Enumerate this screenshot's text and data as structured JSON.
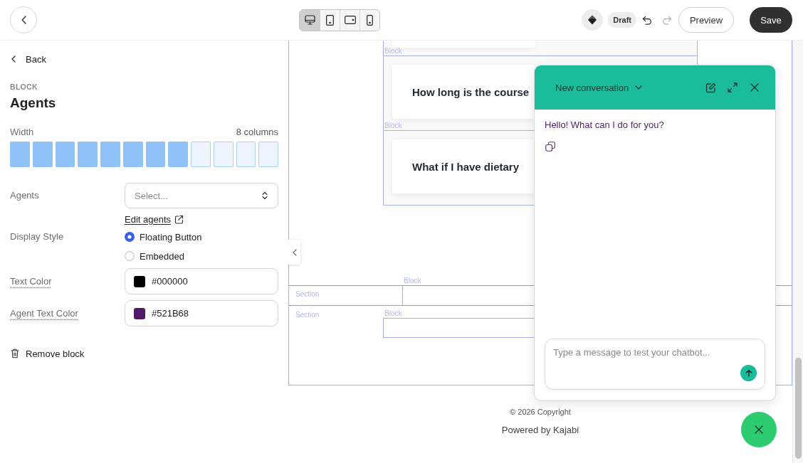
{
  "top_bar": {
    "view_modes": [
      {
        "kind": "desktop",
        "selected": true
      },
      {
        "kind": "tablet",
        "selected": false
      },
      {
        "kind": "tablet_landscape",
        "selected": false
      },
      {
        "kind": "mobile",
        "selected": false
      }
    ],
    "status": "Draft",
    "undo": {
      "disabled": false
    },
    "redo": {
      "disabled": true
    },
    "preview_button": "Preview",
    "save_button": "Save"
  },
  "sidebar": {
    "back_link": "Back",
    "eyebrow": "BLOCK",
    "title": "Agents",
    "width": {
      "label": "Width",
      "value": "8 columns",
      "columns": [
        {
          "filled": true
        },
        {
          "filled": true
        },
        {
          "filled": true
        },
        {
          "filled": true
        },
        {
          "filled": true
        },
        {
          "filled": true
        },
        {
          "filled": true
        },
        {
          "filled": true
        },
        {
          "filled": false
        },
        {
          "filled": false
        },
        {
          "filled": false
        },
        {
          "filled": false
        }
      ]
    },
    "fields": [
      {
        "kind": "select",
        "label": "Agents",
        "has_tooltip": false,
        "placeholder": "Select...",
        "link": "Edit agents"
      },
      {
        "kind": "radio",
        "label": "Display Style",
        "has_tooltip": false,
        "options": [
          {
            "label": "Floating Button",
            "selected": true
          },
          {
            "label": "Embedded",
            "selected": false
          }
        ]
      },
      {
        "kind": "color",
        "label": "Text Color",
        "has_tooltip": true,
        "value": "#000000",
        "color": "#000000"
      },
      {
        "kind": "color",
        "label": "Agent Text Color",
        "has_tooltip": true,
        "value": "#521B68",
        "color": "#521b68"
      }
    ],
    "remove_button": "Remove block"
  },
  "canvas": {
    "faq_blocks": [
      {
        "label": "Block",
        "question": "How long is the course"
      },
      {
        "label": "Block",
        "question": "What if I have dietary"
      }
    ],
    "sections": [
      {
        "label": "Section",
        "block_label": "Block"
      },
      {
        "label": "Section",
        "block_label": "Block"
      }
    ],
    "footer": {
      "copyright": "© 2026 Copyright",
      "credit": "Powered by Kajabi"
    }
  },
  "chat": {
    "open": true,
    "title": "New conversation",
    "messages": [
      {
        "text": "Hello! What can I do for you?"
      }
    ],
    "input": {
      "placeholder": "Type a message to test your chatbot..."
    }
  }
}
